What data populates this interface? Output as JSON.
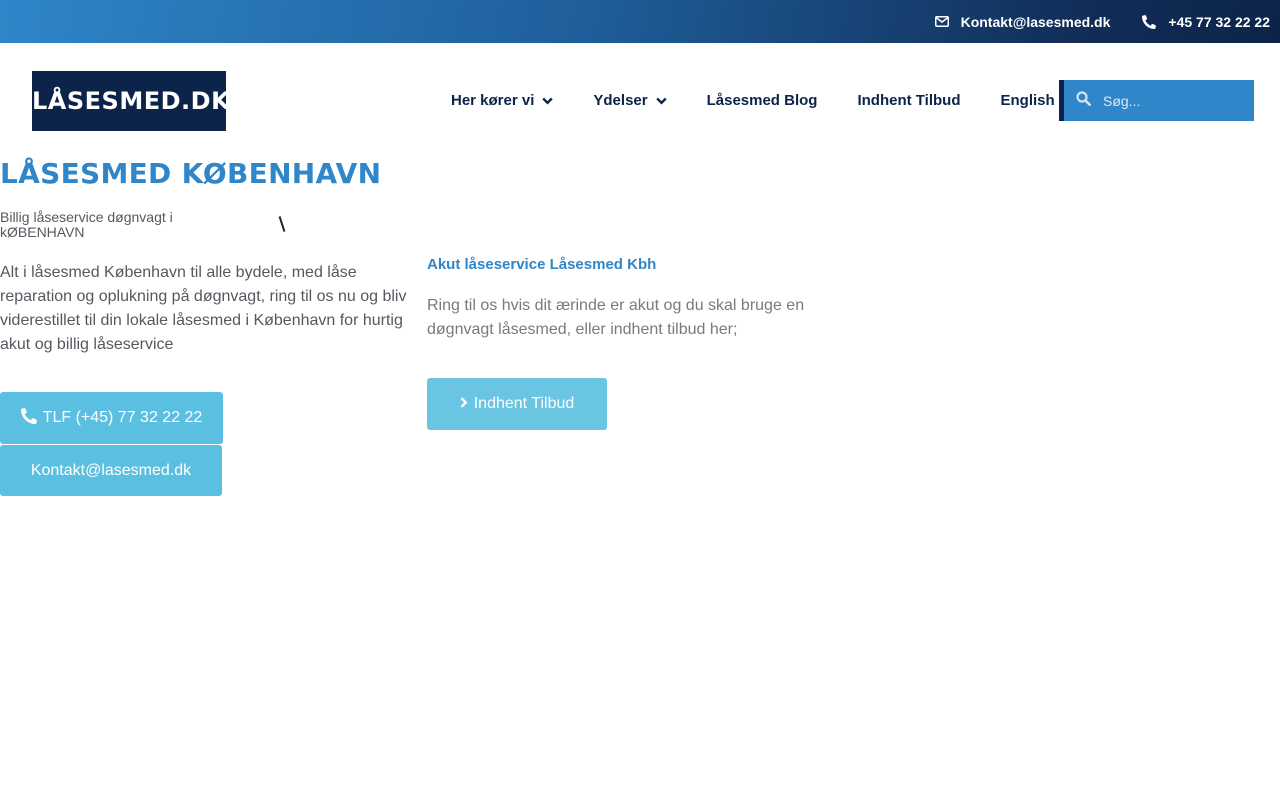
{
  "topbar": {
    "email": "Kontakt@lasesmed.dk",
    "phone": "+45 77 32 22 22",
    "icons": [
      "envelope-icon",
      "phone-icon"
    ]
  },
  "logo": {
    "text": "LÅSESMED.DK"
  },
  "nav": {
    "items": [
      {
        "label": "Her kører vi",
        "has_dropdown": true
      },
      {
        "label": "Ydelser",
        "has_dropdown": true
      },
      {
        "label": "Låsesmed Blog",
        "has_dropdown": false
      },
      {
        "label": "Indhent Tilbud",
        "has_dropdown": false
      },
      {
        "label": "English",
        "has_dropdown": false
      }
    ]
  },
  "search": {
    "placeholder": "Søg..."
  },
  "main": {
    "title": "LÅSESMED KØBENHAVN",
    "subtitle": "Billig låseservice døgnvagt i kØBENHAVN",
    "intro": "Alt i låsesmed København til alle bydele, med låse reparation og oplukning på døgnvagt, ring til os nu og bliv viderestillet til din lokale låsesmed i København for hurtig akut og billig låseservice",
    "phone_button": "TLF (+45) 77 32 22 22",
    "email_button": "Kontakt@lasesmed.dk"
  },
  "col2": {
    "heading": "Akut låseservice Låsesmed Kbh",
    "text": "Ring til os hvis dit ærinde er akut og du skal bruge en døgnvagt låsesmed, eller indhent tilbud her;",
    "button": "Indhent Tilbud"
  },
  "colors": {
    "brand_dark": "#0c2449",
    "brand_blue": "#2f86c8",
    "button_cyan": "#5bbfe1"
  }
}
